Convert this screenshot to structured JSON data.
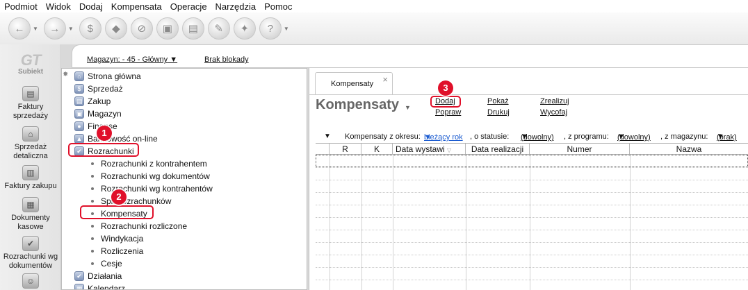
{
  "menubar": [
    "Podmiot",
    "Widok",
    "Dodaj",
    "Kompensata",
    "Operacje",
    "Narzędzia",
    "Pomoc"
  ],
  "toolbar": {
    "buttons": [
      "back-icon",
      "forward-icon",
      "dollar-icon",
      "eraser-icon",
      "no-entry-icon",
      "lock-icon",
      "box-icon",
      "pen-icon",
      "pin-icon",
      "help-icon"
    ]
  },
  "logo": {
    "mark": "GT",
    "name": "Subiekt"
  },
  "launcher": [
    {
      "label": "Faktury sprzedaży",
      "icon": "invoice-sales-icon"
    },
    {
      "label": "Sprzedaż detaliczna",
      "icon": "retail-icon"
    },
    {
      "label": "Faktury zakupu",
      "icon": "invoice-purchase-icon"
    },
    {
      "label": "Dokumenty kasowe",
      "icon": "cash-documents-icon"
    },
    {
      "label": "Rozrachunki wg dokumentów",
      "icon": "settlements-icon"
    }
  ],
  "strip": {
    "magazyn": "Magazyn: - 45 - Główny",
    "blokada": "Brak blokady"
  },
  "tree": {
    "nodes": [
      {
        "label": "Strona główna"
      },
      {
        "label": "Sprzedaż"
      },
      {
        "label": "Zakup"
      },
      {
        "label": "Magazyn"
      },
      {
        "label": "Finanse"
      },
      {
        "label": "Bankowość on-line"
      },
      {
        "label": "Rozrachunki"
      }
    ],
    "subs": [
      "Rozrachunki z kontrahentem",
      "Rozrachunki wg dokumentów",
      "Rozrachunki wg kontrahentów",
      "Spis rozrachunków",
      "Kompensaty",
      "Rozrachunki rozliczone",
      "Windykacja",
      "Rozliczenia",
      "Cesje"
    ],
    "bottom": [
      "Działania",
      "Kalendarz"
    ]
  },
  "badges": [
    "1",
    "2",
    "3"
  ],
  "tab": {
    "label": "Kompensaty",
    "close": "×"
  },
  "page": {
    "title": "Kompensaty",
    "links": {
      "dodaj": "Dodaj",
      "popraw": "Popraw",
      "pokaz": "Pokaż",
      "drukuj": "Drukuj",
      "zrealizuj": "Zrealizuj",
      "wycofaj": "Wycofaj"
    }
  },
  "filter": {
    "okres_label": "Kompensaty z okresu:",
    "okres_value": "bieżący rok",
    "status_label": ", o statusie:",
    "status_value": "(dowolny)",
    "program_label": ", z programu:",
    "program_value": "(dowolny)",
    "magazyn_label": ", z magazynu:",
    "magazyn_value": "(brak)"
  },
  "grid": {
    "columns": [
      "R",
      "K",
      "Data wystawi",
      "Data realizacji",
      "Numer",
      "Nazwa"
    ]
  },
  "colors": {
    "highlight": "#e0102a",
    "link_blue": "#1a5bd0"
  }
}
